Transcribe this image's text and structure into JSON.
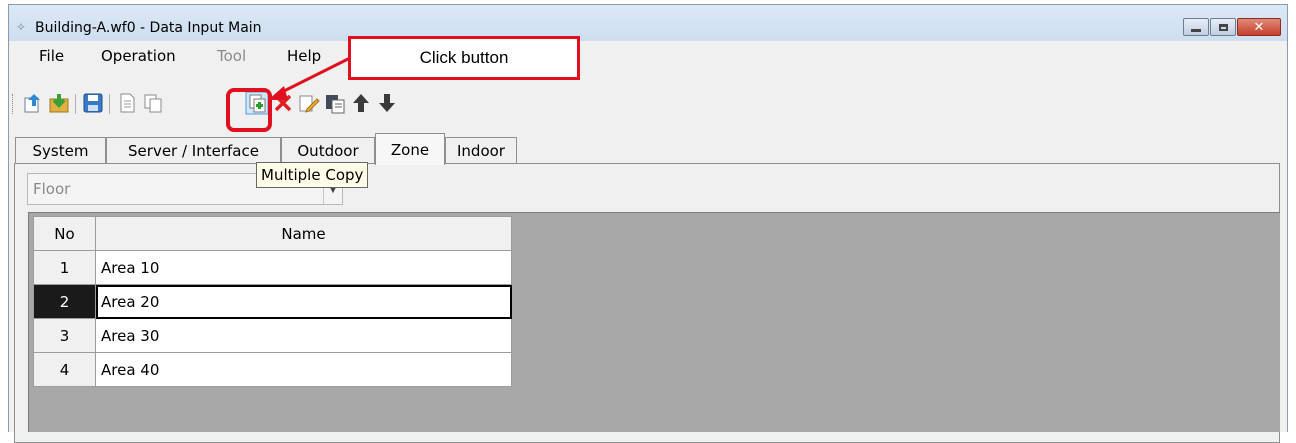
{
  "window": {
    "title": "Building-A.wf0 - Data Input Main",
    "close_glyph": "✕"
  },
  "menu": {
    "file": "File",
    "operation": "Operation",
    "tool": "Tool",
    "help": "Help"
  },
  "toolbar_icons": [
    "upload-icon",
    "download-icon",
    "save-icon",
    "document-icon",
    "copy-icon",
    "multiple-copy-icon",
    "delete-icon",
    "edit-icon",
    "paste-icon",
    "move-up-icon",
    "move-down-icon"
  ],
  "tabs": {
    "system": "System",
    "server": "Server / Interface",
    "outdoor": "Outdoor",
    "zone": "Zone",
    "indoor": "Indoor",
    "active": "Zone"
  },
  "floor_combo": {
    "value": "Floor"
  },
  "table": {
    "headers": {
      "no": "No",
      "name": "Name"
    },
    "rows": [
      {
        "no": "1",
        "name": "Area 10"
      },
      {
        "no": "2",
        "name": "Area 20"
      },
      {
        "no": "3",
        "name": "Area 30"
      },
      {
        "no": "4",
        "name": "Area 40"
      }
    ],
    "selected_row": 2
  },
  "tooltip": {
    "text": "Multiple Copy"
  },
  "annotation": {
    "callout": "Click button",
    "color": "#e0101e"
  }
}
